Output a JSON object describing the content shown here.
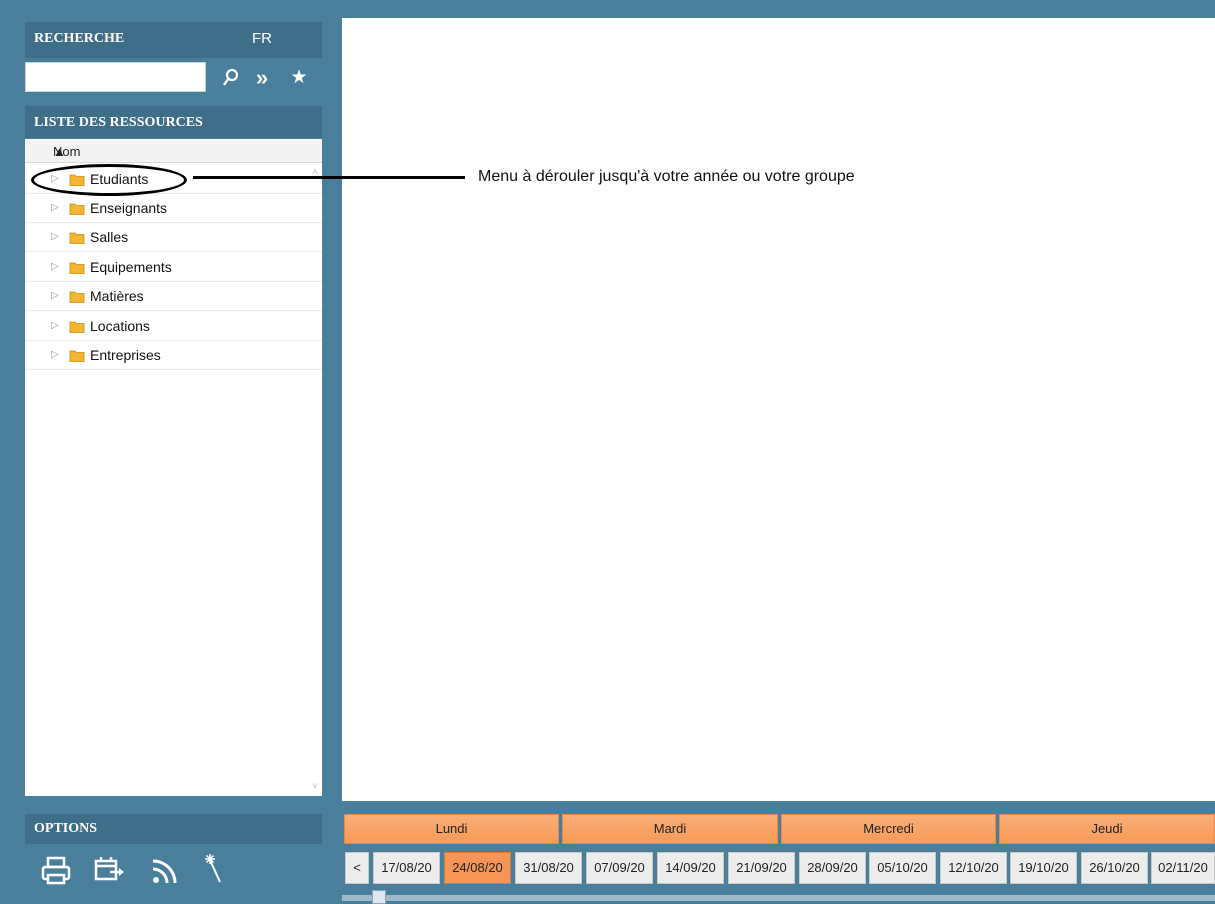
{
  "search": {
    "title": "RECHERCHE",
    "lang": "FR",
    "query": "",
    "search_btn": "⚲",
    "more_btn": "»",
    "fav_btn": "★"
  },
  "resources": {
    "title": "LISTE DES RESSOURCES",
    "column": "Nom",
    "items": [
      {
        "label": "Etudiants"
      },
      {
        "label": "Enseignants"
      },
      {
        "label": "Salles"
      },
      {
        "label": "Equipements"
      },
      {
        "label": "Matières"
      },
      {
        "label": "Locations"
      },
      {
        "label": "Entreprises"
      }
    ]
  },
  "options": {
    "title": "OPTIONS",
    "icons": [
      "print-icon",
      "export-calendar-icon",
      "rss-icon",
      "magic-wand-icon"
    ]
  },
  "annotation": {
    "text": "Menu à dérouler jusqu'à votre année ou votre groupe"
  },
  "days": [
    "Lundi",
    "Mardi",
    "Mercredi",
    "Jeudi"
  ],
  "weeks": {
    "prev": "<",
    "selected": "24/08/20",
    "items": [
      "17/08/20",
      "24/08/20",
      "31/08/20",
      "07/09/20",
      "14/09/20",
      "21/09/20",
      "28/09/20",
      "05/10/20",
      "12/10/20",
      "19/10/20",
      "26/10/20",
      "02/11/20"
    ]
  },
  "colors": {
    "background": "#4a7f9c",
    "header": "#3f6e88",
    "accent": "#f59658",
    "folder": "#f2b632"
  }
}
